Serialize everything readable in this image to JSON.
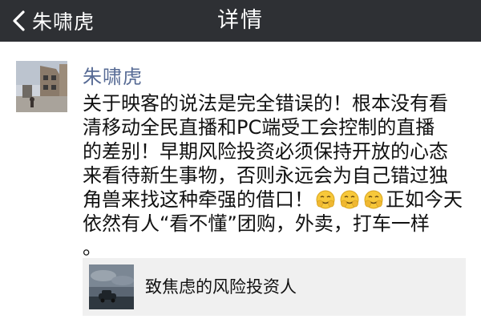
{
  "nav": {
    "back_label": "朱啸虎",
    "title": "详情",
    "background_color": "#2e3034"
  },
  "post": {
    "author": "朱啸虎",
    "author_color": "#576b95",
    "avatar_icon": "city-street-photo-avatar",
    "content_lines": [
      "关于映客的说法是完全错误的！根本没有看",
      "清移动全民直播和PC端受工会控制的直播",
      "的差别！早期风险投资必须保持开放的心态",
      "来看待新生事物，否则永远会为自己错过独",
      "角兽来找这种牵强的借口！",
      "正如今天",
      "依然有人“看不懂”团购，外卖，打车一样",
      "。"
    ],
    "emoji_name": "facepalm-emoji",
    "link": {
      "title": "致焦虑的风险投资人",
      "thumb_icon": "stormy-sky-car-thumbnail"
    }
  }
}
